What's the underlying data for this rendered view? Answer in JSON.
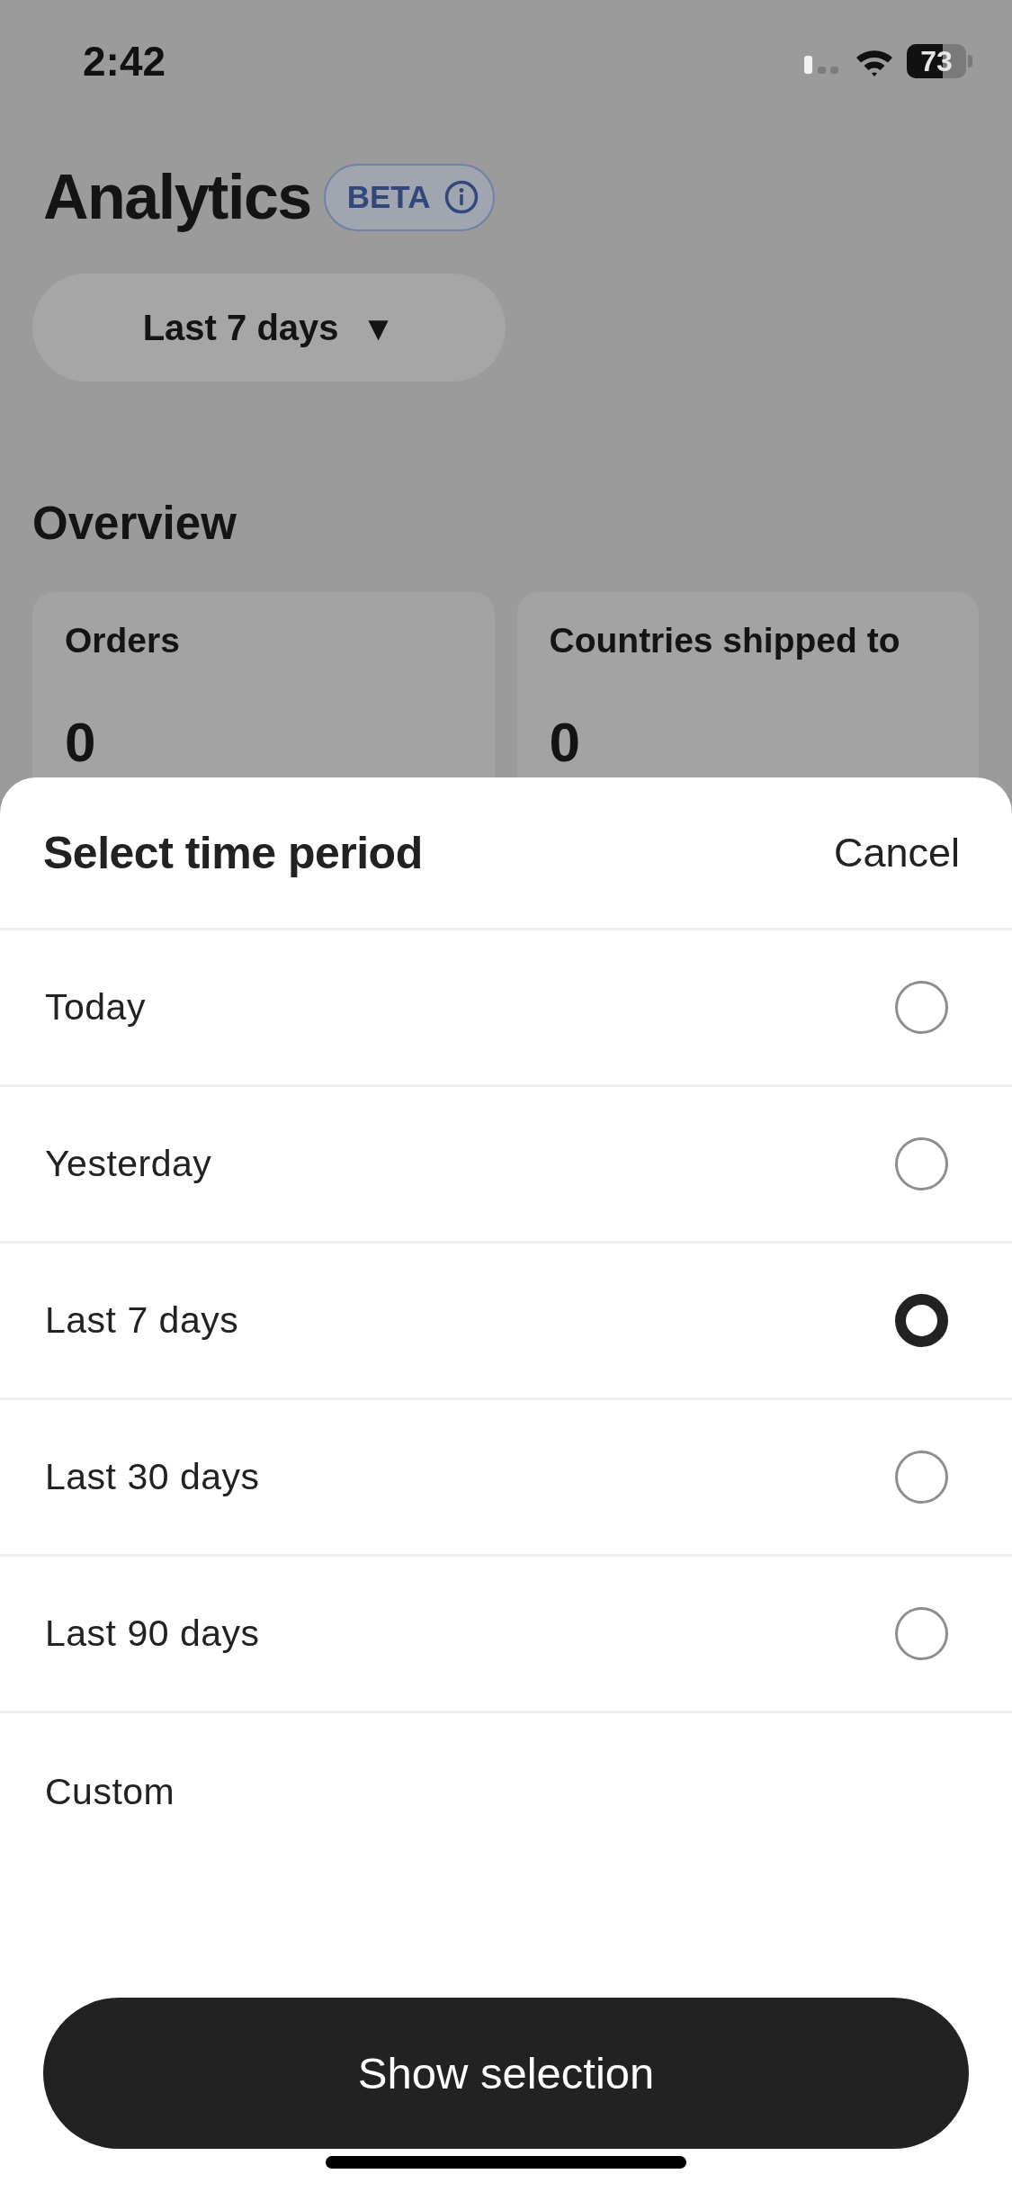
{
  "status_bar": {
    "time": "2:42",
    "battery": "73"
  },
  "page": {
    "title": "Analytics",
    "badge": {
      "label": "BETA"
    },
    "period_dropdown": {
      "value": "Last 7 days",
      "caret": "▼"
    },
    "section_title": "Overview",
    "cards": [
      {
        "label": "Orders",
        "value": "0"
      },
      {
        "label": "Countries shipped to",
        "value": "0"
      }
    ]
  },
  "sheet": {
    "title": "Select time period",
    "cancel": "Cancel",
    "options": [
      {
        "label": "Today",
        "kind": "radio",
        "selected": false
      },
      {
        "label": "Yesterday",
        "kind": "radio",
        "selected": false
      },
      {
        "label": "Last 7 days",
        "kind": "radio",
        "selected": true
      },
      {
        "label": "Last 30 days",
        "kind": "radio",
        "selected": false
      },
      {
        "label": "Last 90 days",
        "kind": "radio",
        "selected": false
      },
      {
        "label": "Custom",
        "kind": "custom"
      }
    ],
    "button": "Show selection"
  }
}
